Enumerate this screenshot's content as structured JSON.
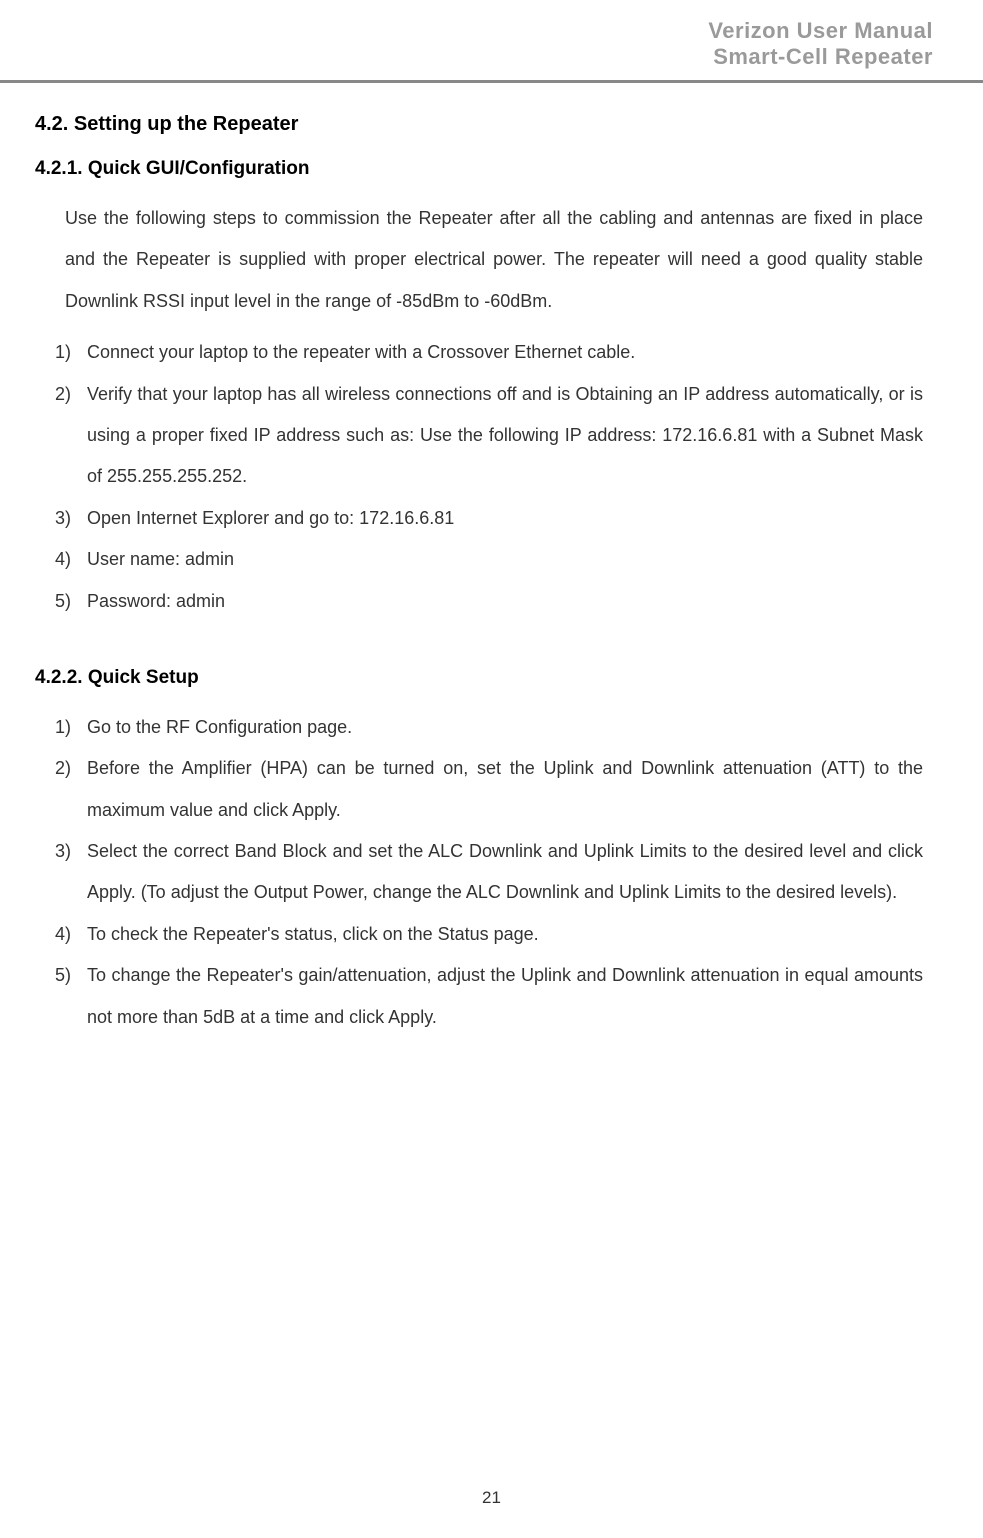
{
  "header": {
    "line1": "Verizon User Manual",
    "line2": "Smart-Cell Repeater"
  },
  "section": {
    "number_title": "4.2.  Setting up the Repeater"
  },
  "subsection1": {
    "number_title": "4.2.1.  Quick GUI/Configuration",
    "intro": "Use the following steps to commission the Repeater after all the cabling and antennas are fixed in place and the Repeater is supplied with proper electrical power.   The repeater will need a good quality stable Downlink RSSI input level in the range of -85dBm to -60dBm.",
    "items": [
      {
        "num": "1)",
        "text": "Connect your laptop to the repeater with a Crossover Ethernet cable."
      },
      {
        "num": "2)",
        "text": "Verify that your laptop has all wireless connections off and is Obtaining an IP address automatically, or is using a proper fixed IP address such as: Use the following IP address: 172.16.6.81 with a Subnet Mask of 255.255.255.252."
      },
      {
        "num": "3)",
        "text": "Open Internet Explorer and go to: 172.16.6.81"
      },
      {
        "num": "4)",
        "text": "User name: admin"
      },
      {
        "num": "5)",
        "text": "Password: admin"
      }
    ]
  },
  "subsection2": {
    "number_title": "4.2.2.  Quick Setup",
    "items": [
      {
        "num": "1)",
        "text": "Go to the RF Configuration page."
      },
      {
        "num": "2)",
        "text": "Before the Amplifier (HPA) can be turned on, set the Uplink and Downlink attenuation (ATT) to the maximum value and click Apply."
      },
      {
        "num": "3)",
        "text": "Select the correct Band Block and set the ALC Downlink and Uplink Limits to the desired   level and click Apply. (To adjust the Output Power, change the ALC Downlink and Uplink Limits to the desired levels)."
      },
      {
        "num": "4)",
        "text": "To check the Repeater's status, click on the Status page."
      },
      {
        "num": "5)",
        "text": "To change the Repeater's gain/attenuation, adjust the Uplink and Downlink attenuation in equal amounts not more than 5dB at a time and click Apply."
      }
    ]
  },
  "footer": {
    "page_number": "21"
  }
}
